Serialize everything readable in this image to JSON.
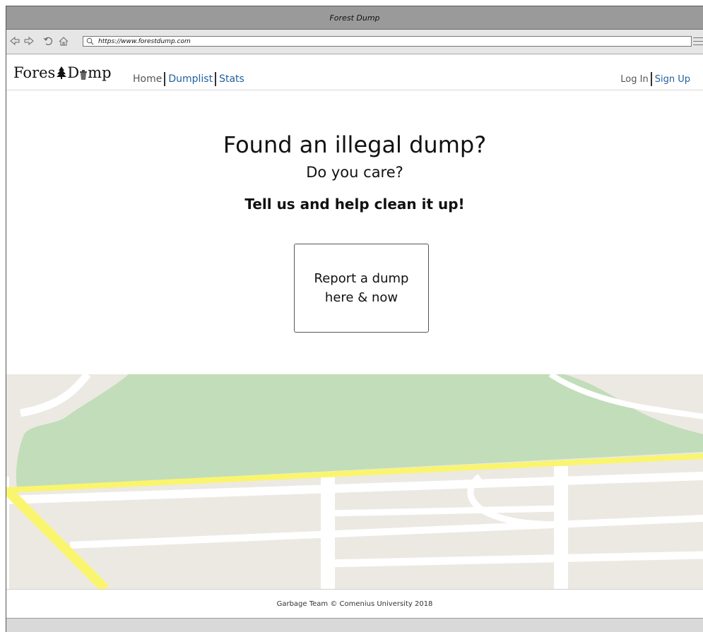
{
  "window": {
    "title": "Forest Dump"
  },
  "browser": {
    "url": "https://www.forestdump.com"
  },
  "icons": [
    "back-icon",
    "forward-icon",
    "reload-icon",
    "home-icon",
    "search-icon",
    "menu-icon",
    "tree-icon",
    "trash-bin-icon"
  ],
  "logo": {
    "part1": "Fores",
    "part2": "D",
    "part3": "mp"
  },
  "nav": {
    "home": "Home",
    "dumplist": "Dumplist",
    "stats": "Stats"
  },
  "auth": {
    "login": "Log In",
    "signup": "Sign Up"
  },
  "hero": {
    "headline": "Found an illegal dump?",
    "subheadline": "Do you care?",
    "tagline": "Tell us and help clean it up!",
    "cta": "Report a dump here & now"
  },
  "footer": {
    "text": "Garbage Team © Comenius University 2018"
  },
  "colors": {
    "link": "#1f5f9f",
    "park": "#c2ddb9",
    "land": "#ece9e3",
    "highway": "#faf56e",
    "road": "#ffffff"
  }
}
